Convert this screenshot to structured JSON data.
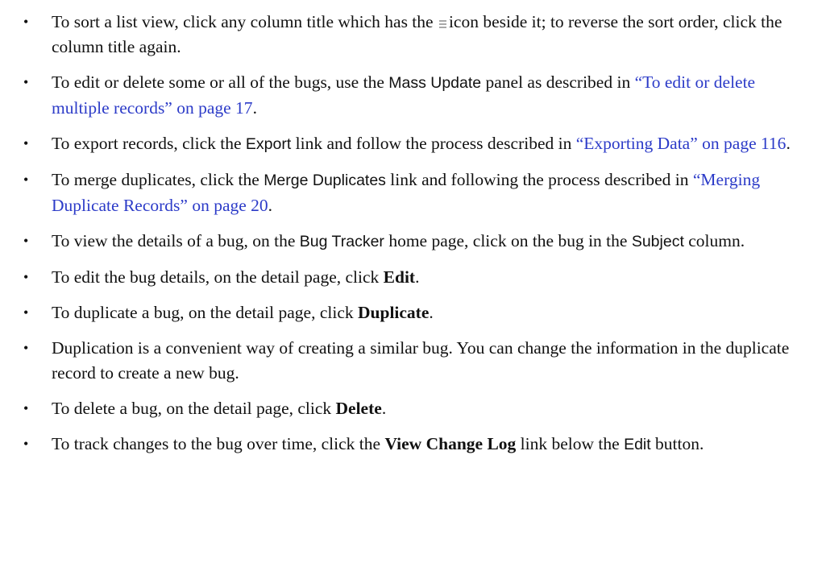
{
  "bullet_symbol": "•",
  "items": [
    {
      "t0": "To sort a list view, click any column title which has the",
      "icon": "sort-icon",
      "t1": "icon beside it; to reverse the sort order, click the column title again."
    },
    {
      "t0": "To edit or delete some or all of the bugs, use the ",
      "ui0": "Mass Update",
      "t1": " panel as described in ",
      "link": "“To edit or delete multiple records” on page 17",
      "t2": "."
    },
    {
      "t0": "To export records, click the ",
      "ui0": "Export",
      "t1": " link and follow the process described in ",
      "link": "“Exporting Data” on page 116",
      "t2": "."
    },
    {
      "t0": "To merge duplicates, click the ",
      "ui0": "Merge Duplicates",
      "t1": " link and following the process described in ",
      "link": "“Merging Duplicate Records” on page 20",
      "t2": "."
    },
    {
      "t0": "To view the details of a bug, on the ",
      "ui0": "Bug Tracker",
      "t1": " home page, click on the bug in the ",
      "ui1": "Subject",
      "t2": " column."
    },
    {
      "t0": "To edit the bug details, on the detail page, click ",
      "bold": "Edit",
      "t1": "."
    },
    {
      "t0": "To duplicate a bug, on the detail page, click ",
      "bold": "Duplicate",
      "t1": "."
    },
    {
      "t0": "Duplication is a convenient way of creating a similar bug. You can change the information in the duplicate record to create a new bug."
    },
    {
      "t0": "To delete a bug, on the detail page, click ",
      "bold": "Delete",
      "t1": "."
    },
    {
      "t0": "To track changes to the bug over time, click the ",
      "bold": "View Change Log",
      "t1": " link below the ",
      "ui0": "Edit",
      "t2": " button."
    }
  ]
}
